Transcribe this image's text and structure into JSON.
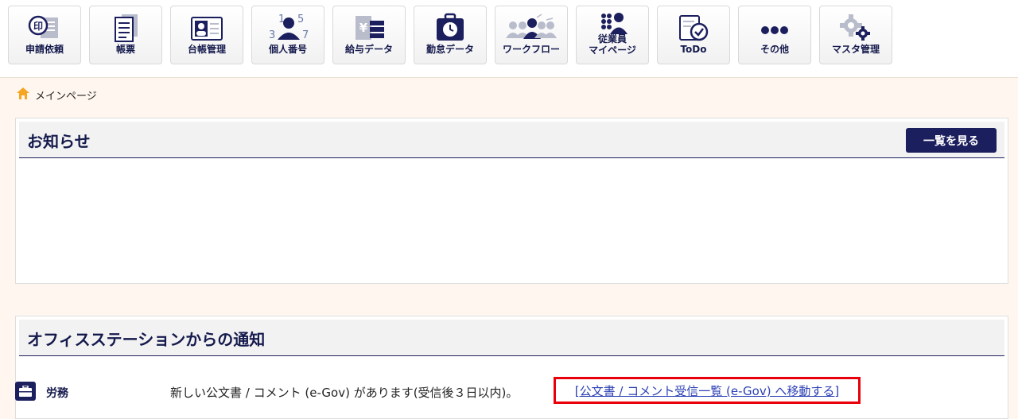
{
  "nav": [
    {
      "label": "申請依頼",
      "icon": "stamp-document-icon"
    },
    {
      "label": "帳票",
      "icon": "form-document-icon"
    },
    {
      "label": "台帳管理",
      "icon": "ledger-card-icon"
    },
    {
      "label": "個人番号",
      "icon": "personal-number-icon",
      "digits": [
        "1",
        "5",
        "3",
        "7"
      ]
    },
    {
      "label": "給与データ",
      "icon": "salary-yen-icon",
      "yen": "¥"
    },
    {
      "label": "勤怠データ",
      "icon": "attendance-clock-icon"
    },
    {
      "label": "ワークフロー",
      "icon": "workflow-people-icon"
    },
    {
      "label": "従業員\nマイページ",
      "icon": "employee-mypage-icon"
    },
    {
      "label": "ToDo",
      "icon": "todo-check-icon"
    },
    {
      "label": "その他",
      "icon": "more-dots-icon"
    },
    {
      "label": "マスタ管理",
      "icon": "gears-icon"
    }
  ],
  "breadcrumb": {
    "label": "メインページ",
    "icon": "home-icon"
  },
  "news": {
    "title": "お知らせ",
    "list_button": "一覧を見る"
  },
  "notices": {
    "title": "オフィスステーションからの通知",
    "rows": [
      {
        "category": "労務",
        "icon": "briefcase-icon",
        "message": "新しい公文書 / コメント (e-Gov) があります(受信後３日以内)。",
        "link": "[公文書 / コメント受信一覧 (e-Gov) へ移動する]"
      }
    ]
  },
  "colors": {
    "navy": "#1c1f5e",
    "highlight": "#e8000b",
    "link": "#2b40b4",
    "background": "#fff7ef"
  }
}
